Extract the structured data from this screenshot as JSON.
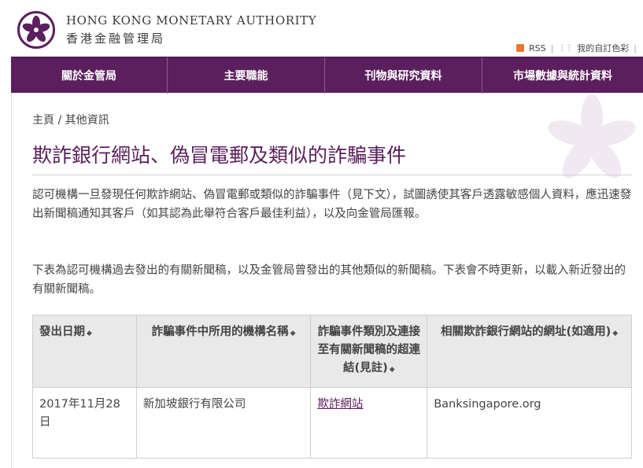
{
  "header": {
    "org_en": "HONG KONG MONETARY AUTHORITY",
    "org_zh": "香港金融管理局",
    "rss_label": "RSS",
    "palette_label": "我的自訂色彩"
  },
  "nav": {
    "items": [
      {
        "label": "關於金管局"
      },
      {
        "label": "主要職能"
      },
      {
        "label": "刊物與研究資料"
      },
      {
        "label": "市場數據與統計資料"
      }
    ]
  },
  "breadcrumb": {
    "home": "主頁",
    "separator": "/",
    "current": "其他資訊"
  },
  "page": {
    "title": "欺詐銀行網站、偽冒電郵及類似的詐騙事件",
    "para1": "認可機構一旦發現任何欺詐網站、偽冒電郵或類似的詐騙事件（見下文），試圖誘使其客戶透露敏感個人資料，應迅速發出新聞稿通知其客戶（如其認為此舉符合客戶最佳利益），以及向金管局匯報。",
    "para2": "下表為認可機構過去發出的有關新聞稿，以及金管局曾發出的其他類似的新聞稿。下表會不時更新，以載入新近發出的有關新聞稿。"
  },
  "table": {
    "headers": [
      "發出日期",
      "詐騙事件中所用的機構名稱",
      "詐騙事件類別及連接至有關新聞稿的超連結(見註)",
      "相關欺詐銀行網站的網址(如適用)"
    ],
    "sort_icon": "sort-icon",
    "rows": [
      {
        "date": "2017年11月28日",
        "institution": "新加坡銀行有限公司",
        "type_link": "欺詐網站",
        "url": "Banksingapore.org"
      }
    ]
  },
  "colors": {
    "brand_purple": "#5b1f5e",
    "header_bg": "#e9e9e9"
  }
}
